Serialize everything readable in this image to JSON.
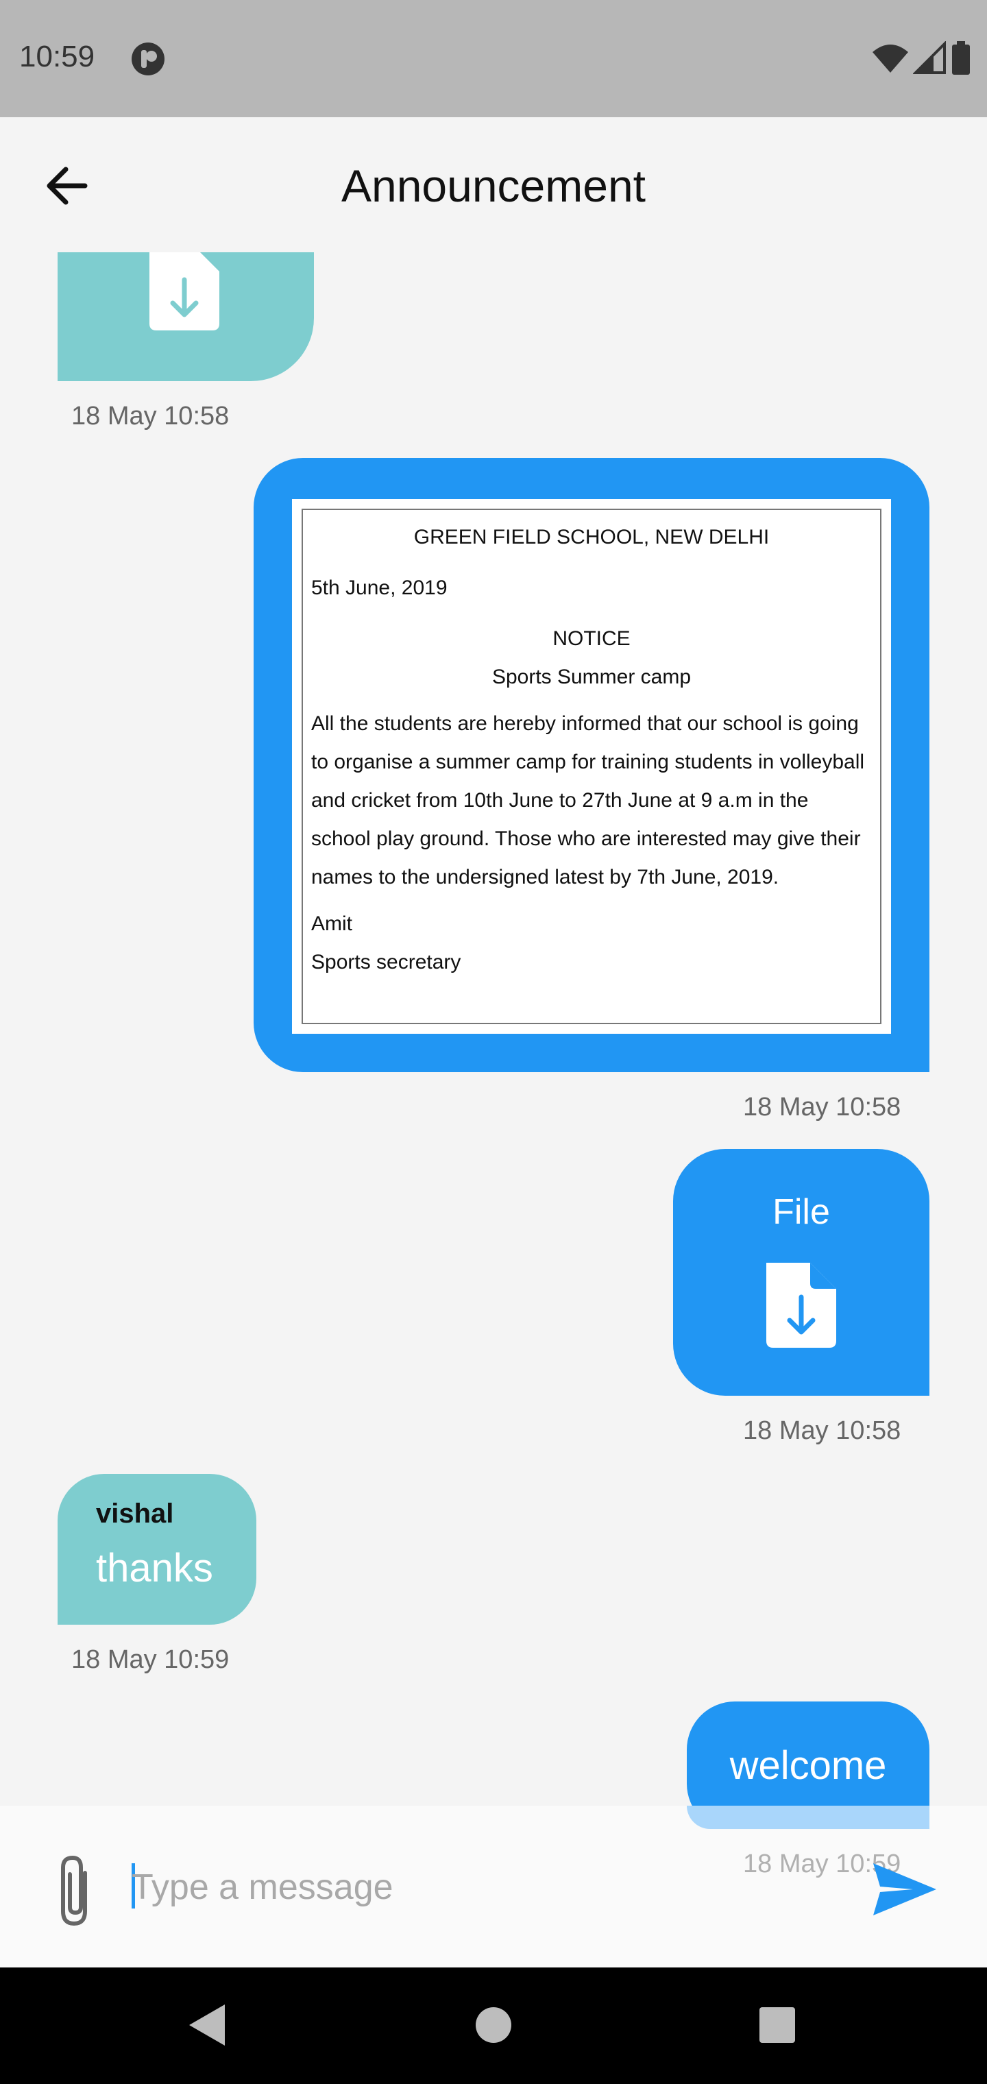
{
  "status_bar": {
    "time": "10:59",
    "app_icon": "p-circle-icon",
    "right_icons": [
      "wifi-icon",
      "signal-icon",
      "battery-icon"
    ]
  },
  "header": {
    "title": "Announcement",
    "back_icon": "arrow-left-icon"
  },
  "messages": [
    {
      "sender": "",
      "type": "file",
      "direction": "incoming",
      "time": "18 May 10:58"
    },
    {
      "type": "image",
      "direction": "outgoing",
      "time": "18 May 10:58",
      "notice": {
        "school": "GREEN FIELD SCHOOL, NEW DELHI",
        "date": "5th June, 2019",
        "heading": "NOTICE",
        "subject": "Sports Summer camp",
        "body": "All the students are hereby informed that our school is going to organise a summer camp for training students in volleyball and cricket from 10th June to 27th June at 9 a.m in the school play ground. Those who are interested may give their names to the undersigned latest by 7th June, 2019.",
        "signer": "Amit",
        "signer_role": "Sports secretary"
      }
    },
    {
      "type": "file",
      "direction": "outgoing",
      "label": "File",
      "time": "18 May 10:58"
    },
    {
      "type": "text",
      "direction": "incoming",
      "sender": "vishal",
      "text": "thanks",
      "time": "18 May 10:59"
    },
    {
      "type": "text",
      "direction": "outgoing",
      "text": "welcome",
      "time": "18 May 10:59"
    }
  ],
  "input": {
    "placeholder": "Type a message",
    "value": "",
    "attach_icon": "paperclip-icon",
    "send_icon": "send-icon"
  },
  "nav": {
    "icons": [
      "back-triangle-icon",
      "home-circle-icon",
      "recents-square-icon"
    ]
  },
  "colors": {
    "incoming_bubble": "#7ecdcf",
    "outgoing_bubble": "#2196f3",
    "status_bar": "#b7b7b7",
    "background": "#f4f4f4"
  }
}
